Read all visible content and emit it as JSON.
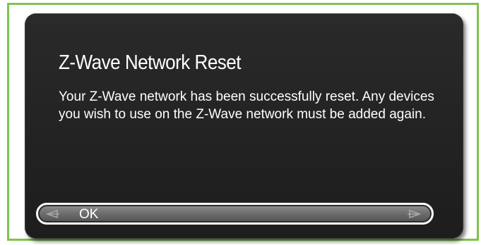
{
  "dialog": {
    "title": "Z-Wave Network Reset",
    "message": "Your Z-Wave network has been successfully reset. Any devices you wish to use on the Z-Wave network must be added again.",
    "option": {
      "label": "OK",
      "left_icon": "arrow-left-icon",
      "right_icon": "arrow-right-icon"
    }
  },
  "colors": {
    "frame_border": "#7fc24e",
    "dialog_background": "#252525",
    "selection_bar": "#6a6a6a",
    "text": "#ffffff"
  }
}
